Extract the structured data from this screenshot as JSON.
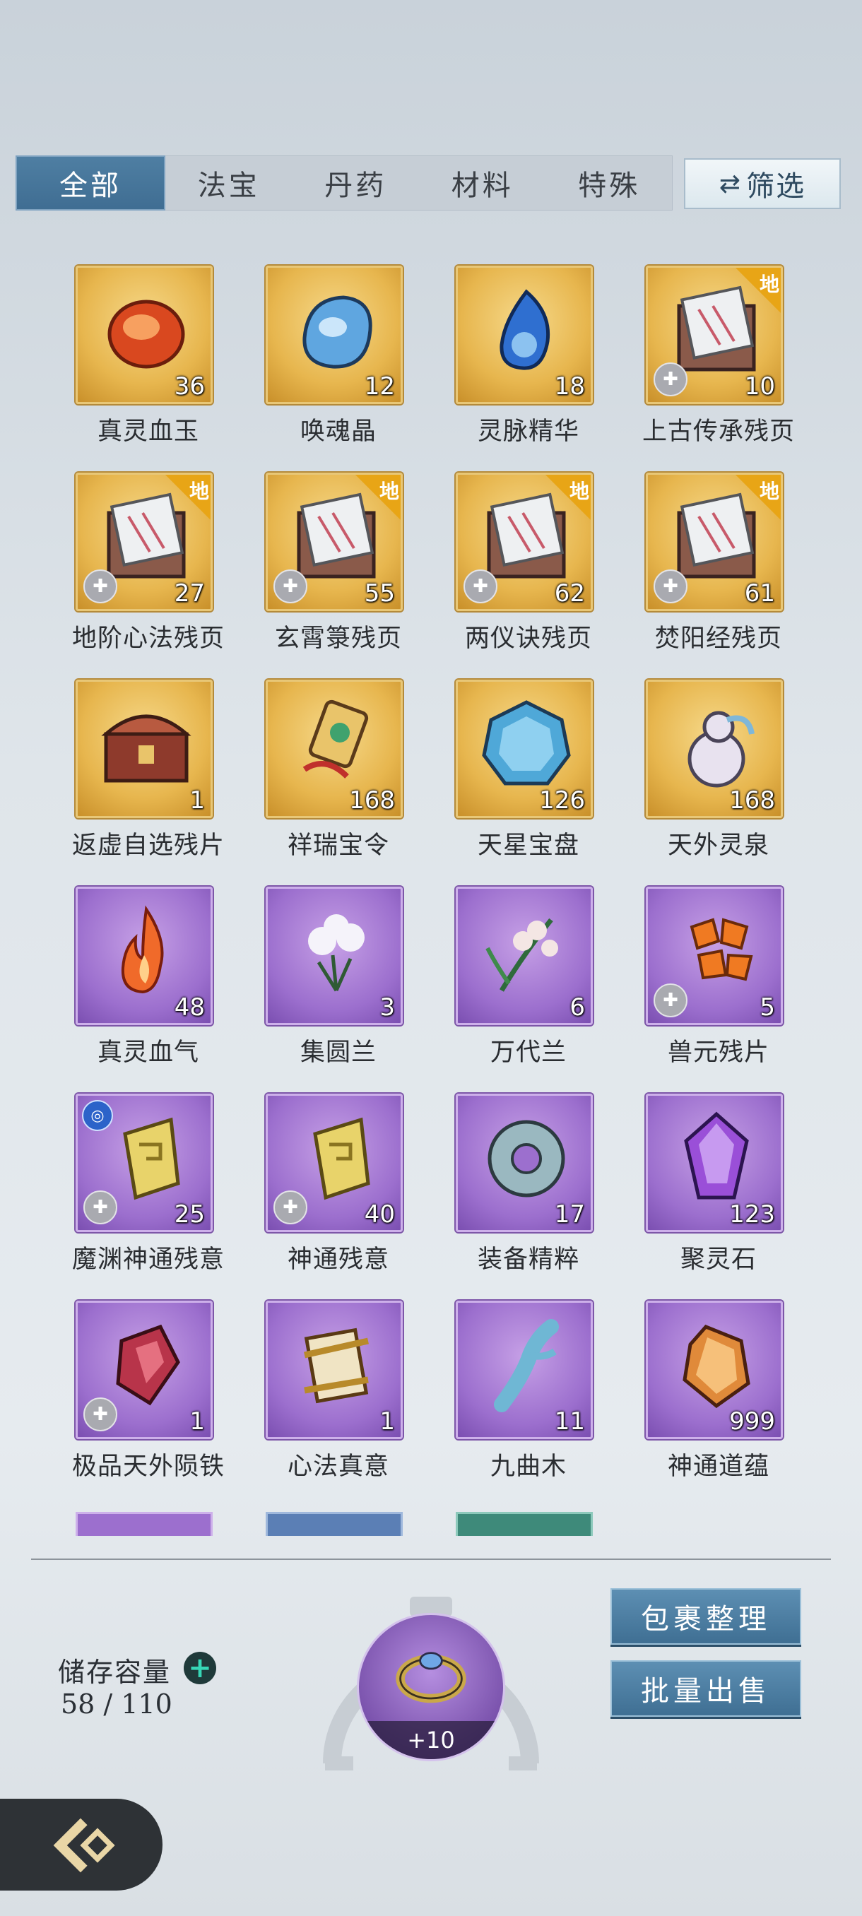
{
  "tabs": [
    {
      "label": "全部",
      "active": true
    },
    {
      "label": "法宝",
      "active": false
    },
    {
      "label": "丹药",
      "active": false
    },
    {
      "label": "材料",
      "active": false
    },
    {
      "label": "特殊",
      "active": false
    }
  ],
  "filter": {
    "icon": "swap-arrows-icon",
    "label": "筛选"
  },
  "items": [
    {
      "name": "真灵血玉",
      "count": "36",
      "rarity": "gold",
      "icon": "blood-jade-icon"
    },
    {
      "name": "唤魂晶",
      "count": "12",
      "rarity": "gold",
      "icon": "soul-crystal-icon"
    },
    {
      "name": "灵脉精华",
      "count": "18",
      "rarity": "gold",
      "icon": "spirit-essence-icon"
    },
    {
      "name": "上古传承残页",
      "count": "10",
      "rarity": "gold",
      "icon": "scroll-page-icon",
      "grade": "地",
      "fragment": true
    },
    {
      "name": "地阶心法残页",
      "count": "27",
      "rarity": "gold",
      "icon": "scroll-page-icon",
      "grade": "地",
      "fragment": true
    },
    {
      "name": "玄霄箓残页",
      "count": "55",
      "rarity": "gold",
      "icon": "scroll-page-icon",
      "grade": "地",
      "fragment": true
    },
    {
      "name": "两仪诀残页",
      "count": "62",
      "rarity": "gold",
      "icon": "scroll-page-icon",
      "grade": "地",
      "fragment": true
    },
    {
      "name": "焚阳经残页",
      "count": "61",
      "rarity": "gold",
      "icon": "scroll-page-icon",
      "grade": "地",
      "fragment": true
    },
    {
      "name": "返虚自选残片",
      "count": "1",
      "rarity": "gold",
      "icon": "treasure-chest-icon"
    },
    {
      "name": "祥瑞宝令",
      "count": "168",
      "rarity": "gold",
      "icon": "token-icon"
    },
    {
      "name": "天星宝盘",
      "count": "126",
      "rarity": "gold",
      "icon": "star-disk-icon"
    },
    {
      "name": "天外灵泉",
      "count": "168",
      "rarity": "gold",
      "icon": "spirit-gourd-icon"
    },
    {
      "name": "真灵血气",
      "count": "48",
      "rarity": "purple",
      "icon": "flame-icon"
    },
    {
      "name": "集圆兰",
      "count": "3",
      "rarity": "purple",
      "icon": "white-flower-icon"
    },
    {
      "name": "万代兰",
      "count": "6",
      "rarity": "purple",
      "icon": "orchid-icon"
    },
    {
      "name": "兽元残片",
      "count": "5",
      "rarity": "purple",
      "icon": "beast-shards-icon",
      "fragment": true
    },
    {
      "name": "魔渊神通残意",
      "count": "25",
      "rarity": "purple",
      "icon": "golden-relic-icon",
      "fragment": true,
      "badge": true
    },
    {
      "name": "神通残意",
      "count": "40",
      "rarity": "purple",
      "icon": "golden-relic-icon",
      "fragment": true
    },
    {
      "name": "装备精粹",
      "count": "17",
      "rarity": "purple",
      "icon": "jade-ring-icon"
    },
    {
      "name": "聚灵石",
      "count": "123",
      "rarity": "purple",
      "icon": "purple-crystal-icon"
    },
    {
      "name": "极品天外陨铁",
      "count": "1",
      "rarity": "purple",
      "icon": "meteor-iron-icon",
      "fragment": true
    },
    {
      "name": "心法真意",
      "count": "1",
      "rarity": "purple",
      "icon": "artifact-icon"
    },
    {
      "name": "九曲木",
      "count": "11",
      "rarity": "purple",
      "icon": "wood-branch-icon"
    },
    {
      "name": "神通道蕴",
      "count": "999",
      "rarity": "purple",
      "icon": "amber-crystal-icon"
    }
  ],
  "storage": {
    "label": "储存容量",
    "value": "58 / 110"
  },
  "equipped": {
    "level": "+10",
    "icon": "ring-icon"
  },
  "actions": {
    "organize": "包裹整理",
    "bulk_sell": "批量出售"
  },
  "colors": {
    "tab_active": "#4a7a9e",
    "gold_tile": "#e7b64e",
    "purple_tile": "#9c6fce",
    "grade_badge": "#e8a516",
    "plus_accent": "#37d6b6"
  }
}
